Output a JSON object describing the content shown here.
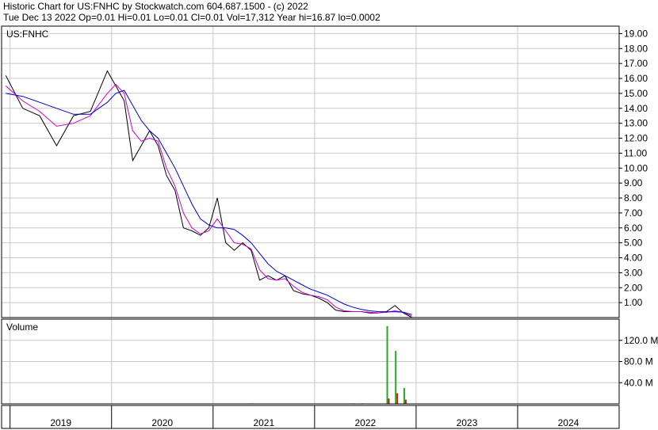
{
  "header": {
    "title": "Historic Chart for US:FNHC by Stockwatch.com 604.687.1500 - (c) 2022",
    "stats": "Tue Dec 13 2022  Op=0.01  Hi=0.01  Lo=0.01  Cl=0.01  Vol=17,312  Year hi=16.87  lo=0.0002"
  },
  "colors": {
    "price": "#000000",
    "ma_short": "#cc00cc",
    "ma_long": "#0000cc",
    "vol_up": "#22aa22",
    "vol_down": "#cc2200",
    "grid": "#c8c8c8"
  },
  "chart_data": [
    {
      "type": "line",
      "title": "US:FNHC",
      "grid": true,
      "y_axis_side": "right",
      "ylim": [
        0,
        19.5
      ],
      "y_ticks": [
        "1.00",
        "2.00",
        "3.00",
        "4.00",
        "5.00",
        "6.00",
        "7.00",
        "8.00",
        "9.00",
        "10.00",
        "11.00",
        "12.00",
        "13.00",
        "14.00",
        "15.00",
        "16.00",
        "17.00",
        "18.00",
        "19.00"
      ],
      "x_labels": [
        "2019",
        "2020",
        "2021",
        "2022",
        "2023",
        "2024"
      ],
      "x": [
        "2018-12",
        "2019-02",
        "2019-04",
        "2019-06",
        "2019-08",
        "2019-10",
        "2019-12",
        "2020-01",
        "2020-02",
        "2020-03",
        "2020-04",
        "2020-05",
        "2020-06",
        "2020-07",
        "2020-08",
        "2020-09",
        "2020-10",
        "2020-11",
        "2020-12",
        "2021-01",
        "2021-02",
        "2021-03",
        "2021-04",
        "2021-05",
        "2021-06",
        "2021-07",
        "2021-08",
        "2021-09",
        "2021-10",
        "2021-11",
        "2021-12",
        "2022-01",
        "2022-02",
        "2022-03",
        "2022-04",
        "2022-05",
        "2022-06",
        "2022-07",
        "2022-08",
        "2022-09",
        "2022-10",
        "2022-11",
        "2022-12"
      ],
      "series": [
        {
          "values": [
            16.2,
            14.0,
            13.5,
            11.5,
            13.5,
            13.8,
            16.5,
            15.5,
            14.5,
            10.5,
            11.5,
            12.5,
            11.5,
            9.5,
            8.5,
            6.0,
            5.8,
            5.5,
            6.0,
            8.0,
            5.0,
            4.5,
            5.0,
            4.5,
            2.5,
            2.8,
            2.5,
            2.8,
            1.8,
            1.6,
            1.5,
            1.3,
            1.0,
            0.5,
            0.4,
            0.4,
            0.4,
            0.3,
            0.3,
            0.4,
            0.8,
            0.3,
            0.01
          ]
        },
        {
          "values": [
            15.5,
            14.5,
            13.8,
            12.8,
            13.0,
            13.5,
            15.0,
            15.6,
            15.0,
            12.5,
            11.8,
            12.0,
            11.8,
            10.0,
            8.8,
            7.0,
            6.0,
            5.6,
            5.8,
            6.6,
            5.8,
            5.0,
            4.9,
            4.6,
            3.2,
            2.6,
            2.5,
            2.6,
            2.1,
            1.7,
            1.5,
            1.4,
            1.2,
            0.7,
            0.45,
            0.4,
            0.4,
            0.35,
            0.32,
            0.35,
            0.45,
            0.35,
            0.1
          ]
        },
        {
          "values": [
            15.0,
            14.8,
            14.4,
            14.0,
            13.6,
            13.6,
            14.4,
            15.0,
            15.2,
            14.2,
            13.2,
            12.5,
            12.0,
            11.0,
            10.0,
            8.8,
            7.6,
            6.6,
            6.2,
            6.0,
            6.0,
            5.9,
            5.5,
            5.0,
            4.3,
            3.6,
            3.1,
            2.8,
            2.5,
            2.2,
            1.9,
            1.7,
            1.5,
            1.2,
            0.9,
            0.7,
            0.55,
            0.45,
            0.4,
            0.38,
            0.38,
            0.36,
            0.2
          ]
        }
      ]
    },
    {
      "type": "bar",
      "title": "Volume",
      "ylim": [
        0,
        160
      ],
      "y_ticks": [
        "40.0 M",
        "80.0 M",
        "120.0 M"
      ],
      "x": [
        "2021-05",
        "2022-05",
        "2022-06",
        "2022-07",
        "2022-08",
        "2022-09",
        "2022-10",
        "2022-11"
      ],
      "series": [
        {
          "values": [
            1,
            1,
            1,
            0.8,
            0.5,
            147,
            100,
            30
          ]
        },
        {
          "values": [
            0,
            0.5,
            0.5,
            0.6,
            0.4,
            10,
            20,
            8
          ]
        }
      ]
    }
  ]
}
